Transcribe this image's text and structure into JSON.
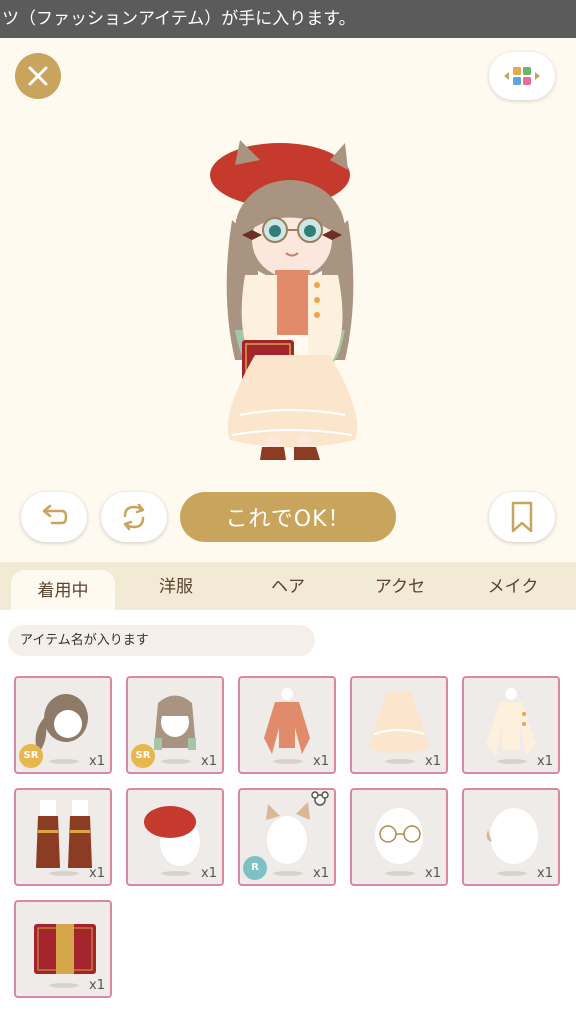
{
  "banner": {
    "text": "ツ（ファッションアイテム）が手に入ります。"
  },
  "stage": {
    "close_icon": "close-icon",
    "palette_icon": "color-palette-icon"
  },
  "controls": {
    "undo_icon": "undo-icon",
    "rotate_icon": "rotate-icon",
    "ok_label": "これでOK！",
    "bookmark_icon": "bookmark-icon"
  },
  "tabs": [
    {
      "label": "着用中",
      "active": true
    },
    {
      "label": "洋服",
      "active": false
    },
    {
      "label": "ヘア",
      "active": false
    },
    {
      "label": "アクセ",
      "active": false
    },
    {
      "label": "メイク",
      "active": false
    }
  ],
  "item_name_placeholder": "アイテム名が入ります",
  "items": [
    {
      "name": "ponytail-hair",
      "qty": "x1",
      "rarity": "SR"
    },
    {
      "name": "long-straight-hair",
      "qty": "x1",
      "rarity": "SR"
    },
    {
      "name": "blouse",
      "qty": "x1",
      "rarity": ""
    },
    {
      "name": "lace-skirt",
      "qty": "x1",
      "rarity": ""
    },
    {
      "name": "cardigan",
      "qty": "x1",
      "rarity": ""
    },
    {
      "name": "boots",
      "qty": "x1",
      "rarity": ""
    },
    {
      "name": "red-beret",
      "qty": "x1",
      "rarity": ""
    },
    {
      "name": "cat-ears",
      "qty": "x1",
      "rarity": "R"
    },
    {
      "name": "round-glasses",
      "qty": "x1",
      "rarity": ""
    },
    {
      "name": "ear-accessory",
      "qty": "x1",
      "rarity": ""
    },
    {
      "name": "book",
      "qty": "x1",
      "rarity": ""
    }
  ],
  "colors": {
    "accent": "#c9a45c",
    "cell_border": "#d9899f",
    "tab_bar": "#f3ead6"
  }
}
